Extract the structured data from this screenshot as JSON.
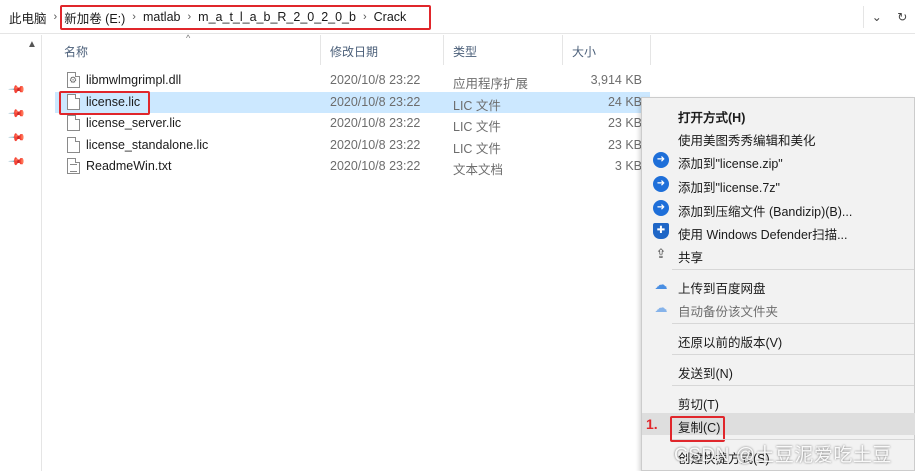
{
  "address": {
    "crumbs": [
      "此电脑",
      "新加卷 (E:)",
      "matlab",
      "m_a_t_l_a_b_R_2_0_2_0_b",
      "Crack"
    ],
    "dropdown_icon": "chevron-down-icon",
    "refresh_icon": "refresh-icon"
  },
  "columns": {
    "name": "名称",
    "date": "修改日期",
    "type": "类型",
    "size": "大小"
  },
  "files": [
    {
      "name": "libmwlmgrimpl.dll",
      "date": "2020/10/8 23:22",
      "type": "应用程序扩展",
      "size": "3,914 KB",
      "icon": "dll"
    },
    {
      "name": "license.lic",
      "date": "2020/10/8 23:22",
      "type": "LIC 文件",
      "size": "24 KB",
      "icon": "file",
      "selected": true
    },
    {
      "name": "license_server.lic",
      "date": "2020/10/8 23:22",
      "type": "LIC 文件",
      "size": "23 KB",
      "icon": "file"
    },
    {
      "name": "license_standalone.lic",
      "date": "2020/10/8 23:22",
      "type": "LIC 文件",
      "size": "23 KB",
      "icon": "file"
    },
    {
      "name": "ReadmeWin.txt",
      "date": "2020/10/8 23:22",
      "type": "文本文档",
      "size": "3 KB",
      "icon": "txt"
    }
  ],
  "context_menu": {
    "open_with": "打开方式(H)",
    "meitu": "使用美图秀秀编辑和美化",
    "add_zip": "添加到\"license.zip\"",
    "add_7z": "添加到\"license.7z\"",
    "add_bandizip": "添加到压缩文件 (Bandizip)(B)...",
    "defender": "使用 Windows Defender扫描...",
    "share": "共享",
    "upload_baidu": "上传到百度网盘",
    "auto_backup": "自动备份该文件夹",
    "restore": "还原以前的版本(V)",
    "send_to": "发送到(N)",
    "cut": "剪切(T)",
    "copy": "复制(C)",
    "create_shortcut": "创建快捷方式(S)"
  },
  "annotation": {
    "step": "1."
  },
  "watermark": "CSDN @土豆泥爱吃土豆",
  "colors": {
    "highlight_red": "#e0262b",
    "selection_blue": "#cce8ff",
    "menu_bg": "#f2f2f2"
  }
}
